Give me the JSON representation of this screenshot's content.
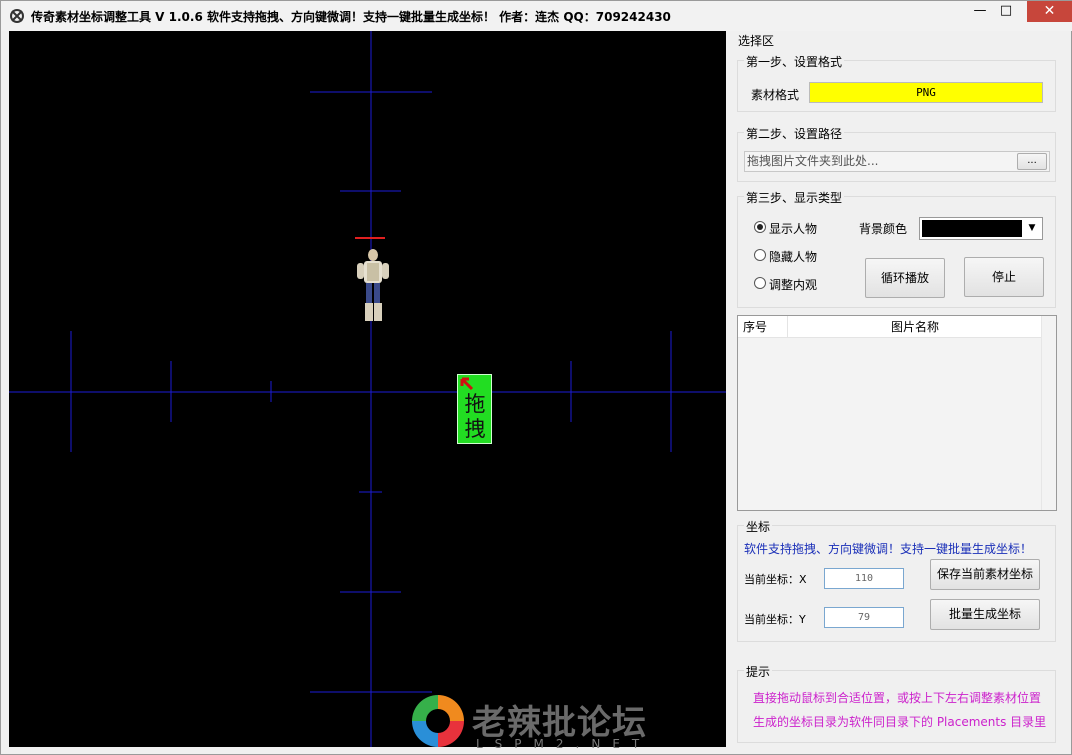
{
  "window": {
    "title": "传奇素材坐标调整工具 V 1.0.6  软件支持拖拽、方向键微调！支持一键批量生成坐标！ 作者：连杰 QQ：709242430",
    "controls": {
      "minimize": "—",
      "maximize": "□",
      "close": "✕"
    }
  },
  "canvas": {
    "background": "#000000",
    "drag_label": "拖拽"
  },
  "side": {
    "section_title": "选择区",
    "step1": {
      "title": "第一步、设置格式",
      "label": "素材格式",
      "value": "PNG",
      "color": "#ffff00"
    },
    "step2": {
      "title": "第二步、设置路径",
      "placeholder": "拖拽图片文件夹到此处...",
      "browse": "..."
    },
    "step3": {
      "title": "第三步、显示类型",
      "radios": [
        "显示人物",
        "隐藏人物",
        "调整内观"
      ],
      "selected": "显示人物",
      "bg_label": "背景颜色",
      "bg_value": "#000000",
      "loop_button": "循环播放",
      "stop_button": "停止"
    },
    "list": {
      "columns": [
        "序号",
        "图片名称"
      ],
      "rows": []
    },
    "coords": {
      "title": "坐标",
      "notice": "软件支持拖拽、方向键微调！支持一键批量生成坐标！",
      "x_label": "当前坐标：X",
      "x_value": "110",
      "y_label": "当前坐标：Y",
      "y_value": "79",
      "save_button": "保存当前素材坐标",
      "batch_button": "批量生成坐标"
    },
    "hint": {
      "title": "提示",
      "line1": "直接拖动鼠标到合适位置，或按上下左右调整素材位置",
      "line2": "生成的坐标目录为软件同目录下的 Placements 目录里"
    }
  },
  "watermark": {
    "cn": "老辣批论坛",
    "en": "LSPM2.NET"
  }
}
